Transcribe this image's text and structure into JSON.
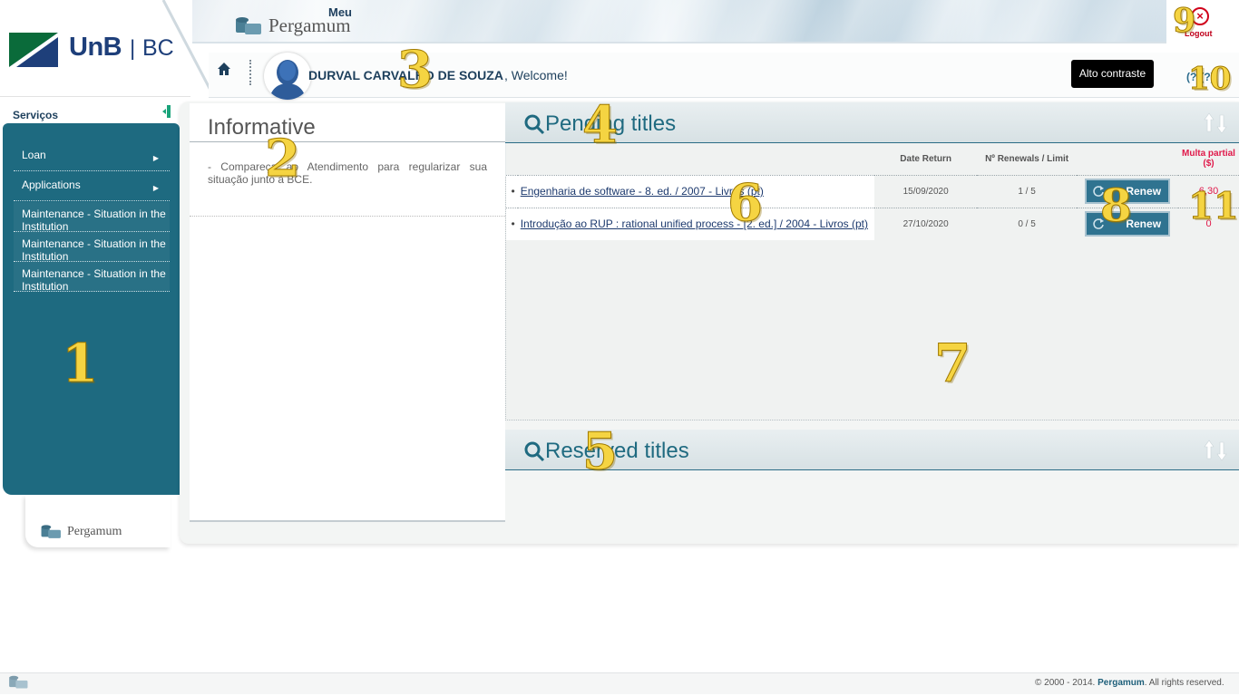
{
  "header": {
    "org_name": "UnB",
    "org_unit": "BC",
    "app_prefix": "Meu",
    "app_name": "Pergamum",
    "logout_label": "Logout",
    "user_name": "DURVAL CARVALHO DE SOUZA",
    "welcome_text": ", Welcome!",
    "contrast_button": "Alto contraste",
    "help_label": "(?)(?)"
  },
  "sidebar": {
    "title": "Serviços",
    "items": [
      {
        "label": "Loan",
        "has_submenu": true
      },
      {
        "label": "Applications",
        "has_submenu": true
      },
      {
        "label": "Maintenance - Situation in the Institution",
        "has_submenu": false
      },
      {
        "label": "Maintenance - Situation in the Institution",
        "has_submenu": false
      },
      {
        "label": "Maintenance - Situation in the Institution",
        "has_submenu": false
      }
    ],
    "footer_logo": "Pergamum"
  },
  "informative": {
    "title": "Informative",
    "text": "- Compareça ao Atendimento para regularizar sua situação junto à BCE."
  },
  "pending": {
    "title": "Pending titles",
    "columns": [
      "",
      "Date Return",
      "Nº Renewals / Limit",
      "",
      "Multa partial ($)"
    ],
    "rows": [
      {
        "title": "Engenharia de software - 8. ed. / 2007 - Livros (pt)",
        "date_return": "15/09/2020",
        "renewals": "1 / 5",
        "action": "Renew",
        "fine": "6,30"
      },
      {
        "title": "Introdução ao RUP : rational unified process - [2. ed.] / 2004 - Livros (pt)",
        "date_return": "27/10/2020",
        "renewals": "0 / 5",
        "action": "Renew",
        "fine": "0"
      }
    ]
  },
  "reserved": {
    "title": "Reserved titles"
  },
  "footer": {
    "copyright_prefix": "© 2000 - 2014.",
    "brand": "Pergamum",
    "copyright_suffix": ". All rights reserved."
  },
  "markers": [
    "1",
    "2",
    "3",
    "4",
    "5",
    "6",
    "7",
    "8",
    "9",
    "10",
    "11"
  ],
  "colors": {
    "sidebar": "#1e6a80",
    "heading": "#1f6a80",
    "fine": "#e0194a",
    "logout": "#d0021b",
    "marker": "#f5d442"
  }
}
